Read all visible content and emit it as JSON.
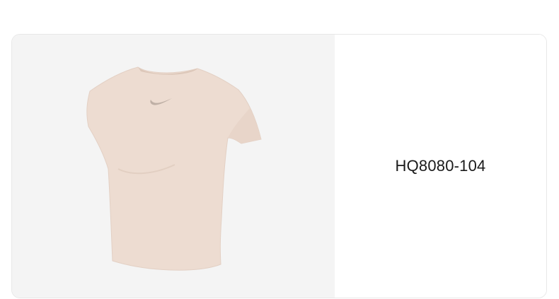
{
  "product": {
    "sku": "HQ8080-104",
    "image_icon": "tshirt-icon",
    "image_color": "#eddcd1",
    "logo_icon": "swoosh-icon"
  }
}
